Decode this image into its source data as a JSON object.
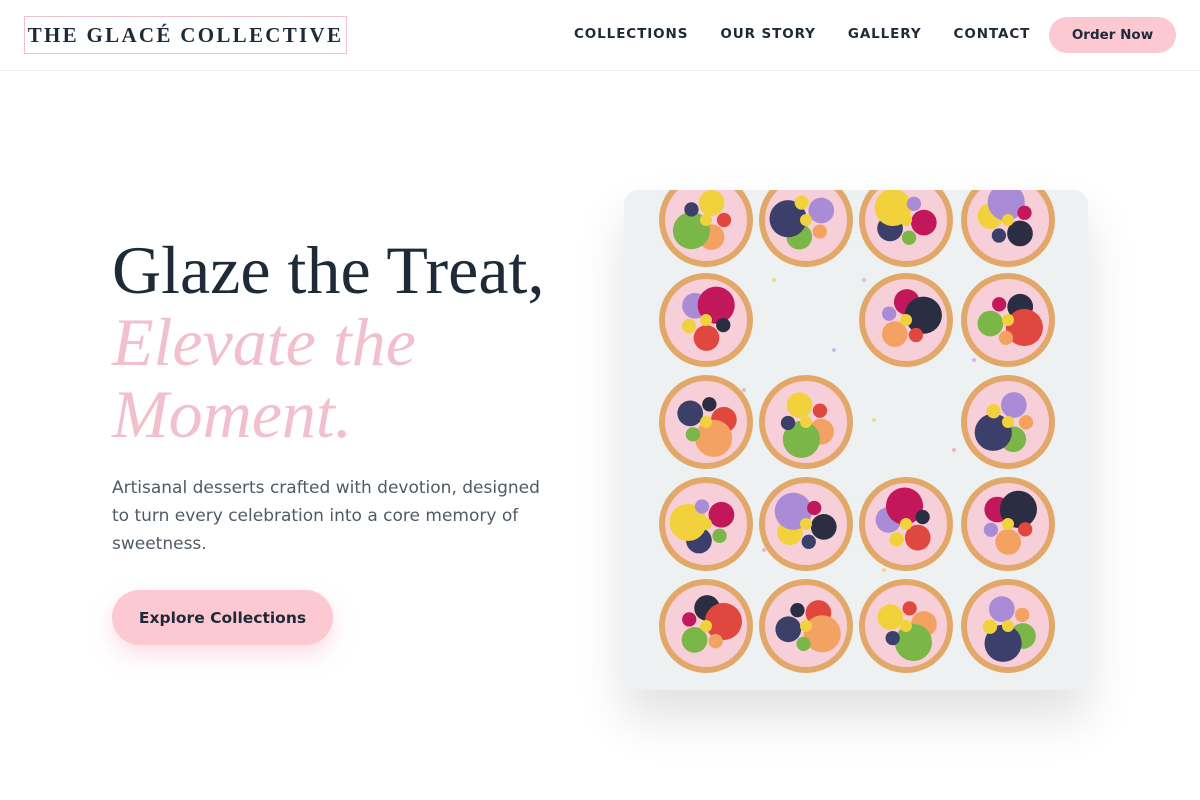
{
  "brand": {
    "logo_text": "THE GLACÉ COLLECTIVE"
  },
  "nav": {
    "links": [
      "COLLECTIONS",
      "OUR STORY",
      "GALLERY",
      "CONTACT"
    ],
    "cta_label": "Order Now"
  },
  "hero": {
    "heading_line1": "Glaze the Treat,",
    "heading_line2": "Elevate the",
    "heading_line3": "Moment.",
    "description": "Artisanal desserts crafted with devotion, designed to turn every celebration into a core memory of sweetness.",
    "cta_label": "Explore Collections"
  },
  "colors": {
    "navy": "#1e2a38",
    "pink": "#fcc9d2",
    "pink_text": "#f2bfcc",
    "body_text": "#505a64"
  }
}
